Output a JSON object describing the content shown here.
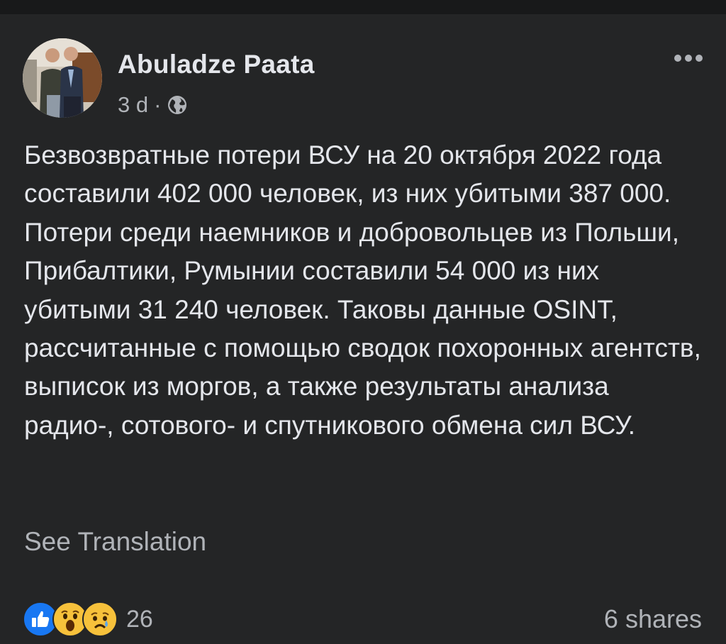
{
  "post": {
    "author": "Abuladze Paata",
    "time": "3 d",
    "separator": "·",
    "privacy_icon": "globe-icon",
    "more_icon": "more-options-icon",
    "text": "Безвозвратные потери ВСУ на 20 октября 2022 года составили 402 000 человек, из них убитыми 387 000. Потери среди наемников и добровольцев из Польши, Прибалтики, Румынии составили 54 000 из них убитыми 31 240 человек. Таковы данные OSINT, рассчитанные с помощью сводок похоронных агентств, выписок из моргов, а также результаты анализа радио-, сотового- и спутникового обмена сил ВСУ.",
    "see_translation": "See Translation"
  },
  "footer": {
    "reactions": [
      "like-icon",
      "wow-icon",
      "sad-icon"
    ],
    "reaction_count": "26",
    "shares": "6 shares"
  },
  "colors": {
    "background": "#242526",
    "text_primary": "#e4e6eb",
    "text_secondary": "#b0b3b8",
    "like_blue": "#1877f2",
    "emoji_yellow": "#f7c13b"
  }
}
